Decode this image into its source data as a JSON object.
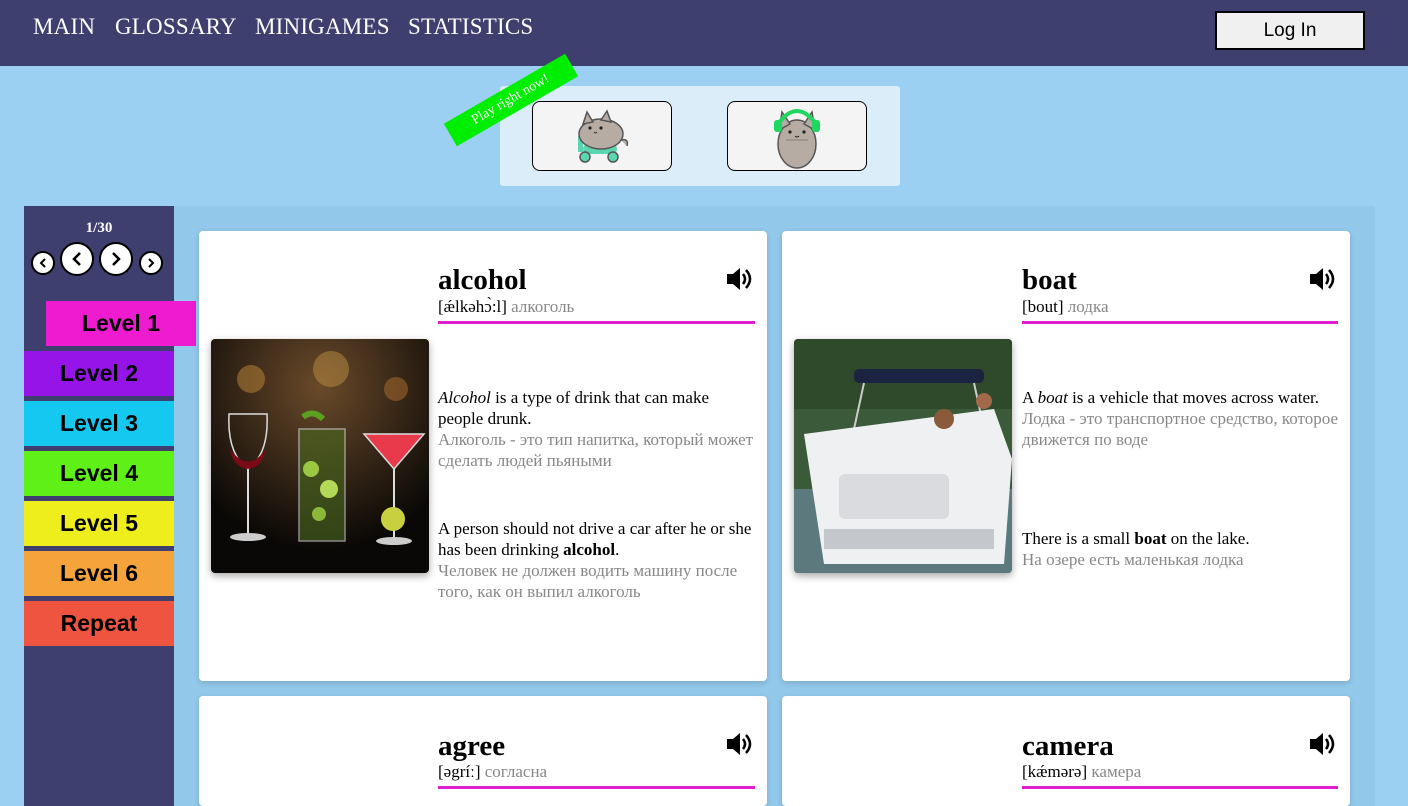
{
  "nav": {
    "main": "MAIN",
    "glossary": "GLOSSARY",
    "minigames": "MINIGAMES",
    "statistics": "STATISTICS",
    "login": "Log In"
  },
  "minigames": {
    "banner": "Play right now!",
    "games": [
      {
        "icon": "pusheen-scooter-icon"
      },
      {
        "icon": "pusheen-headphones-icon"
      }
    ]
  },
  "sidebar": {
    "counter": "1/30",
    "levels": [
      {
        "label": "Level 1",
        "color": "#ee1bd0",
        "active": true
      },
      {
        "label": "Level 2",
        "color": "#9614e8"
      },
      {
        "label": "Level 3",
        "color": "#14c8ef"
      },
      {
        "label": "Level 4",
        "color": "#5ef017"
      },
      {
        "label": "Level 5",
        "color": "#eeee1d"
      },
      {
        "label": "Level 6",
        "color": "#f4a43a"
      },
      {
        "label": "Repeat",
        "color": "#ee5440"
      }
    ]
  },
  "cards": [
    {
      "word": "alcohol",
      "ipa": "[ǽlkəhɔ̀:l]",
      "ru": "алкоголь",
      "def_word": "Alcohol",
      "def_rest": " is a type of drink that can make people drunk.",
      "def_ru": "Алкоголь - это тип напитка, который может сделать людей пьяными",
      "ex_pre": "A person should not drive a car after he or she has been drinking ",
      "ex_word": "alcohol",
      "ex_post": ".",
      "ex_ru": "Человек не должен водить машину после того, как он выпил алкоголь"
    },
    {
      "word": "boat",
      "ipa": "[bout]",
      "ru": "лодка",
      "def_pre": "A ",
      "def_word": "boat",
      "def_rest": " is a vehicle that moves across water.",
      "def_ru": "Лодка - это транспортное средство, которое движется по воде",
      "ex_pre": "There is a small ",
      "ex_word": "boat",
      "ex_post": " on the lake.",
      "ex_ru": "На озере есть маленькая лодка"
    },
    {
      "word": "agree",
      "ipa": "[əgríː]",
      "ru": "согласна"
    },
    {
      "word": "camera",
      "ipa": "[kǽmərə]",
      "ru": "камера"
    }
  ],
  "colors": {
    "header": "#3e3f6e",
    "background": "#9bd0f2",
    "underline": "#e01ecf",
    "banner": "#00ee00"
  }
}
